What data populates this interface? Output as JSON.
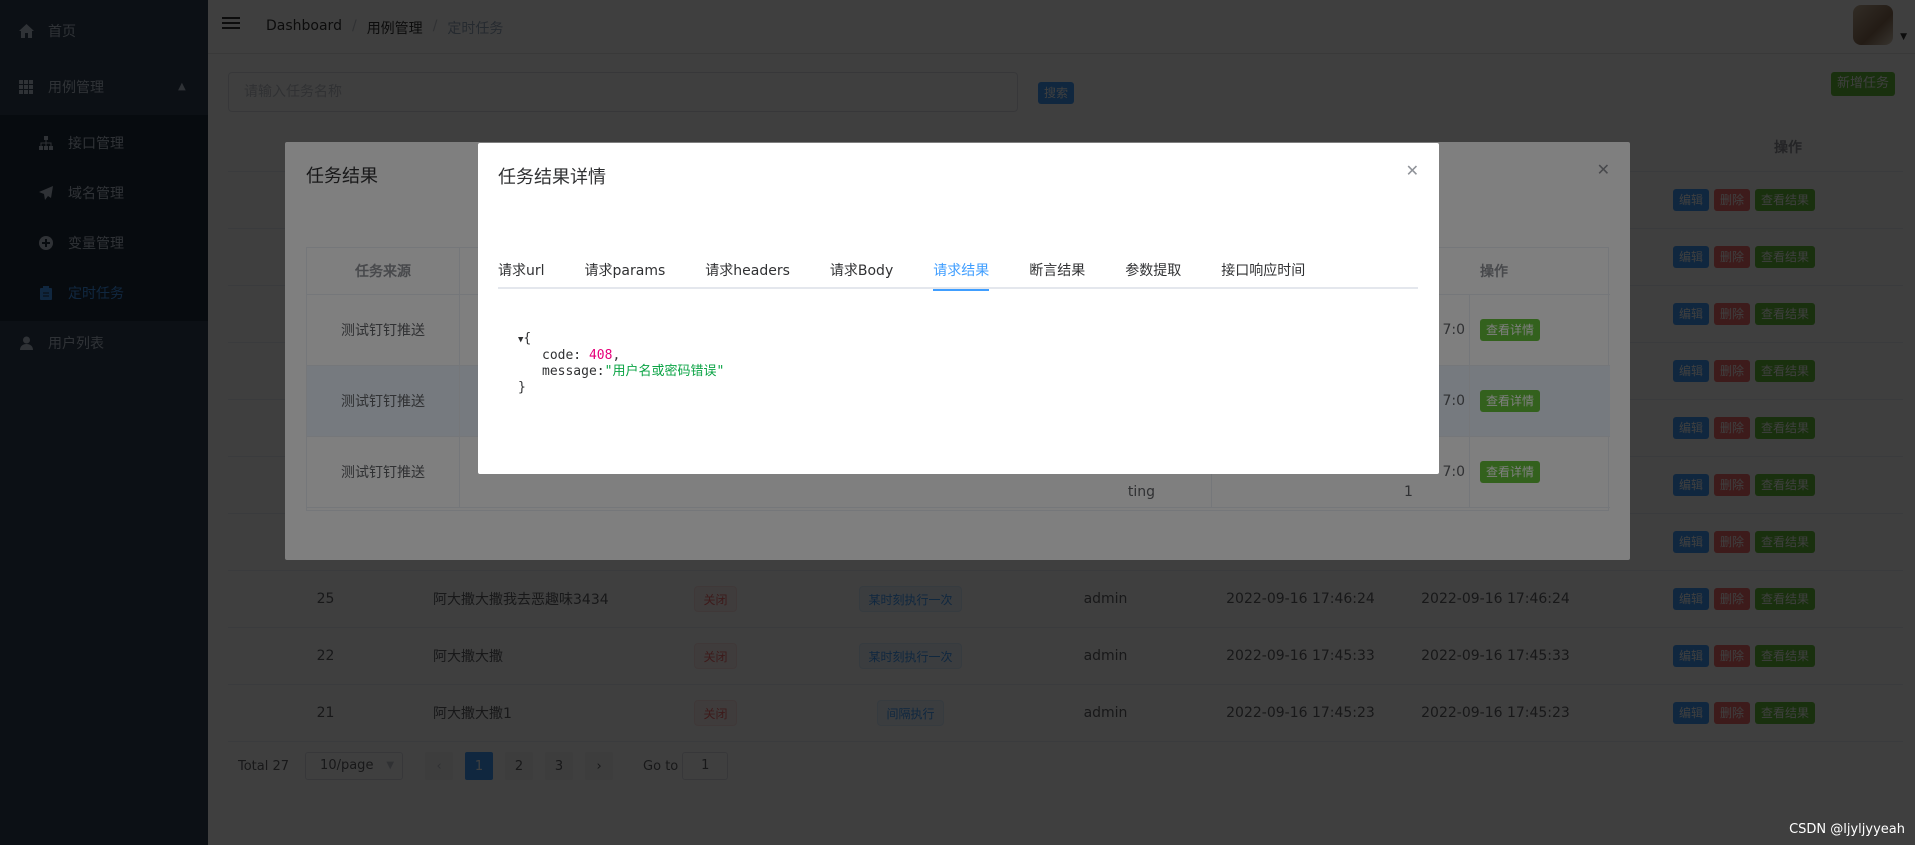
{
  "sidebar": {
    "items": [
      {
        "label": "首页",
        "icon": "home-icon"
      },
      {
        "label": "用例管理",
        "icon": "grid-icon"
      },
      {
        "label": "接口管理",
        "icon": "sitemap-icon"
      },
      {
        "label": "域名管理",
        "icon": "send-icon"
      },
      {
        "label": "变量管理",
        "icon": "circle-plus-icon"
      },
      {
        "label": "定时任务",
        "icon": "clipboard-icon"
      },
      {
        "label": "用户列表",
        "icon": "user-icon"
      }
    ]
  },
  "navbar": {
    "breadcrumb": [
      "Dashboard",
      "用例管理",
      "定时任务"
    ]
  },
  "toolbar": {
    "search_placeholder": "请输入任务名称",
    "search_label": "搜索",
    "add_label": "新增任务"
  },
  "table": {
    "header_ops": "操作",
    "rows": [
      {
        "id": "25",
        "name": "阿大撒大撒我去恶趣味3434",
        "status": "关闭",
        "cycle": "某时刻执行一次",
        "creator": "admin",
        "created": "2022-09-16 17:46:24",
        "updated": "2022-09-16 17:46:24"
      },
      {
        "id": "22",
        "name": "阿大撒大撒",
        "status": "关闭",
        "cycle": "某时刻执行一次",
        "creator": "admin",
        "created": "2022-09-16 17:45:33",
        "updated": "2022-09-16 17:45:33"
      },
      {
        "id": "21",
        "name": "阿大撒大撒1",
        "status": "关闭",
        "cycle": "间隔执行",
        "creator": "admin",
        "created": "2022-09-16 17:45:23",
        "updated": "2022-09-16 17:45:23"
      }
    ],
    "ops": {
      "edit": "编辑",
      "delete": "删除",
      "view": "查看结果"
    }
  },
  "pagination": {
    "total": "Total 27",
    "page_size": "10/page",
    "pages": [
      "1",
      "2",
      "3"
    ],
    "goto_label": "Go to",
    "goto_value": "1"
  },
  "dialog_results": {
    "title": "任务结果",
    "col_source": "任务来源",
    "col_ops": "操作",
    "rows": [
      {
        "source": "测试钉钉推送",
        "partial": "7:0",
        "extra": ""
      },
      {
        "source": "测试钉钉推送",
        "partial": "7:0",
        "extra": ""
      },
      {
        "source": "测试钉钉推送",
        "partial": "7:0",
        "extra": "ting",
        "extra2": "1"
      }
    ],
    "view_detail": "查看详情"
  },
  "dialog_detail": {
    "title": "任务结果详情",
    "tabs": [
      "请求url",
      "请求params",
      "请求headers",
      "请求Body",
      "请求结果",
      "断言结果",
      "参数提取",
      "接口响应时间"
    ],
    "active_tab": 4,
    "json": {
      "code_key": "code:",
      "code_value": "408",
      "message_key": "message:",
      "message_value": "\"用户名或密码错误\""
    }
  },
  "watermark": "CSDN @ljyljyyeah"
}
